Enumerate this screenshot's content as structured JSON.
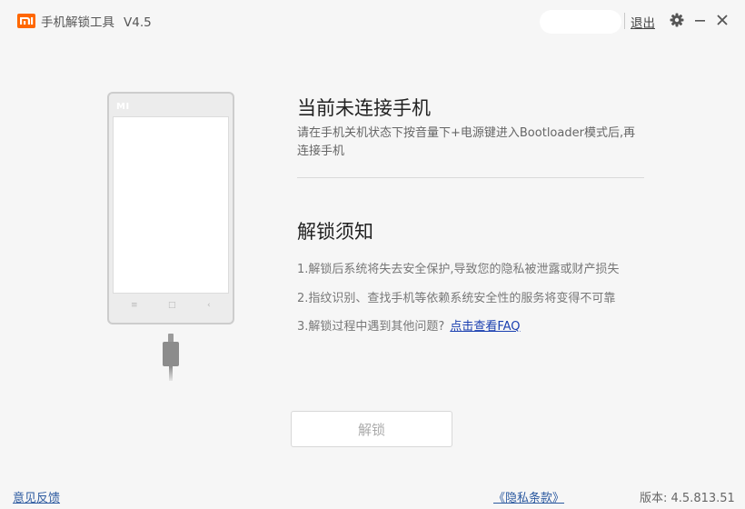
{
  "titlebar": {
    "app_title": "手机解锁工具",
    "version": "V4.5",
    "logout_label": "退出",
    "icons": [
      "mi-logo",
      "gear-icon",
      "minimize-icon",
      "close-icon"
    ],
    "logo_color": "#ff6700"
  },
  "phone": {
    "brand_mark": "MI",
    "nav_keys": [
      "≡",
      "□",
      "‹"
    ]
  },
  "status": {
    "heading": "当前未连接手机",
    "description": "请在手机关机状态下按音量下+电源键进入Bootloader模式后,再连接手机"
  },
  "notice": {
    "heading": "解锁须知",
    "items": [
      "1.解锁后系统将失去安全保护,导致您的隐私被泄露或财产损失",
      "2.指纹识别、查找手机等依赖系统安全性的服务将变得不可靠",
      "3.解锁过程中遇到其他问题?"
    ],
    "faq_link": "点击查看FAQ"
  },
  "actions": {
    "unlock_label": "解锁",
    "unlock_enabled": false
  },
  "footer": {
    "feedback": "意见反馈",
    "privacy": "《隐私条款》",
    "version": "版本: 4.5.813.51"
  }
}
